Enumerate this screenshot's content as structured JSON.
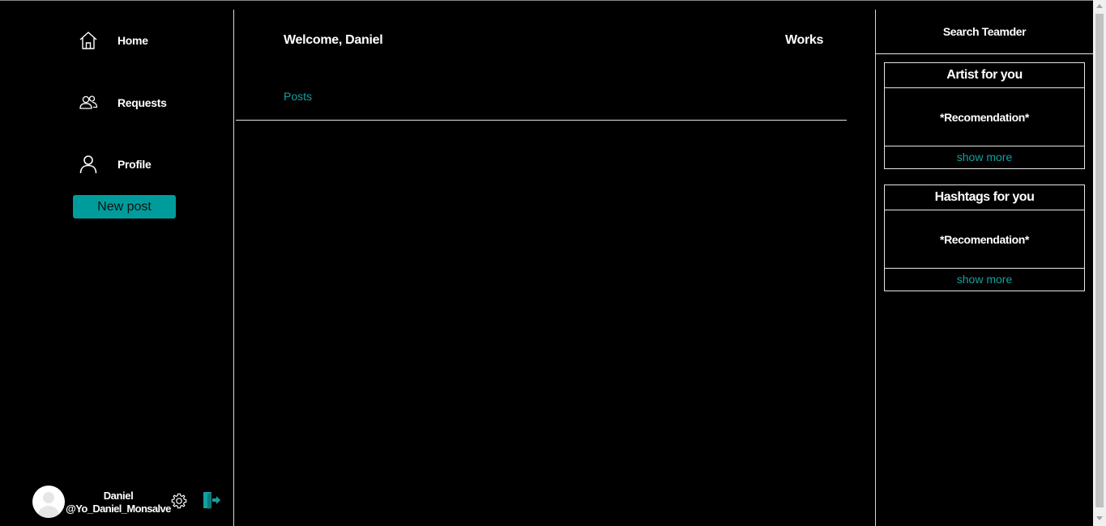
{
  "sidebar": {
    "nav": [
      {
        "label": "Home",
        "icon": "home-icon"
      },
      {
        "label": "Requests",
        "icon": "users-icon"
      },
      {
        "label": "Profile",
        "icon": "user-icon"
      }
    ],
    "new_post_label": "New post",
    "user": {
      "name": "Daniel",
      "handle": "@Yo_Daniel_Monsalve"
    },
    "settings_icon": "gear-icon",
    "logout_icon": "logout-icon"
  },
  "main": {
    "welcome": "Welcome, Daniel",
    "works_label": "Works",
    "posts_tab": "Posts"
  },
  "right": {
    "search_label": "Search Teamder",
    "boxes": [
      {
        "title": "Artist for you",
        "body": "*Recomendation*",
        "more": "show more"
      },
      {
        "title": "Hashtags for you",
        "body": "*Recomendation*",
        "more": "show more"
      }
    ]
  },
  "colors": {
    "background": "#000000",
    "accent": "#009c9c",
    "text": "#ffffff"
  }
}
